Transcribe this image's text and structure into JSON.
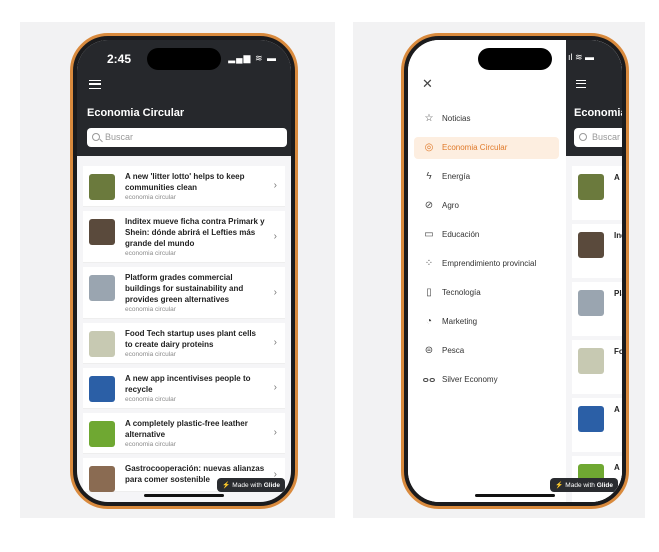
{
  "left_phone": {
    "status_time": "2:45",
    "status_icons": "▂▄▆ ≋ ▬",
    "title": "Economia Circular",
    "search_placeholder": "Buscar",
    "items": [
      {
        "title": "A new 'litter lotto' helps to keep communities clean",
        "category": "economia circular",
        "thumb_color": "#6b7a3d"
      },
      {
        "title": "Inditex mueve ficha contra Primark y Shein: dónde abrirá el Lefties más grande del mundo",
        "category": "economia circular",
        "thumb_color": "#5a4a3c"
      },
      {
        "title": "Platform grades commercial buildings for sustainability and provides green alternatives",
        "category": "economia circular",
        "thumb_color": "#9aa5b0"
      },
      {
        "title": "Food Tech startup uses plant cells to create dairy proteins",
        "category": "economia circular",
        "thumb_color": "#c7c9b2"
      },
      {
        "title": "A new app incentivises people to recycle",
        "category": "economia circular",
        "thumb_color": "#2b5fa6"
      },
      {
        "title": "A completely plastic-free leather alternative",
        "category": "economia circular",
        "thumb_color": "#6fa832"
      },
      {
        "title": "Gastrocooperación: nuevas alianzas para comer sostenible",
        "category": "",
        "thumb_color": "#8a6b52"
      }
    ],
    "glide_badge": "Made with",
    "glide_brand": "Glide"
  },
  "right_phone": {
    "peek_status": "ıl ≋ ▬",
    "peek_title": "Economia",
    "peek_search": "Buscar",
    "peek_items": [
      "A r",
      "Ind",
      "Pla",
      "Fo",
      "A r",
      "A c",
      "Ga"
    ],
    "nav_items": [
      {
        "label": "Noticias",
        "icon": "☆",
        "icon_name": "star-icon",
        "active": false
      },
      {
        "label": "Economia Circular",
        "icon": "◎",
        "icon_name": "recycle-icon",
        "active": true
      },
      {
        "label": "Energía",
        "icon": "ϟ",
        "icon_name": "bolt-icon",
        "active": false
      },
      {
        "label": "Agro",
        "icon": "⊘",
        "icon_name": "leaf-icon",
        "active": false
      },
      {
        "label": "Educación",
        "icon": "▭",
        "icon_name": "book-icon",
        "active": false
      },
      {
        "label": "Emprendimiento provincial",
        "icon": "⁘",
        "icon_name": "sparkle-icon",
        "active": false
      },
      {
        "label": "Tecnología",
        "icon": "▯",
        "icon_name": "phone-icon",
        "active": false
      },
      {
        "label": "Marketing",
        "icon": "◔",
        "icon_name": "chart-icon",
        "active": false
      },
      {
        "label": "Pesca",
        "icon": "⊜",
        "icon_name": "fish-icon",
        "active": false
      },
      {
        "label": "Silver Economy",
        "icon": "ⴰⴰ",
        "icon_name": "people-icon",
        "active": false
      }
    ],
    "glide_badge": "Made with",
    "glide_brand": "Glide"
  },
  "colors": {
    "header_bg": "#26282c",
    "accent": "#e07a2a",
    "frame": "#d98a3d"
  }
}
